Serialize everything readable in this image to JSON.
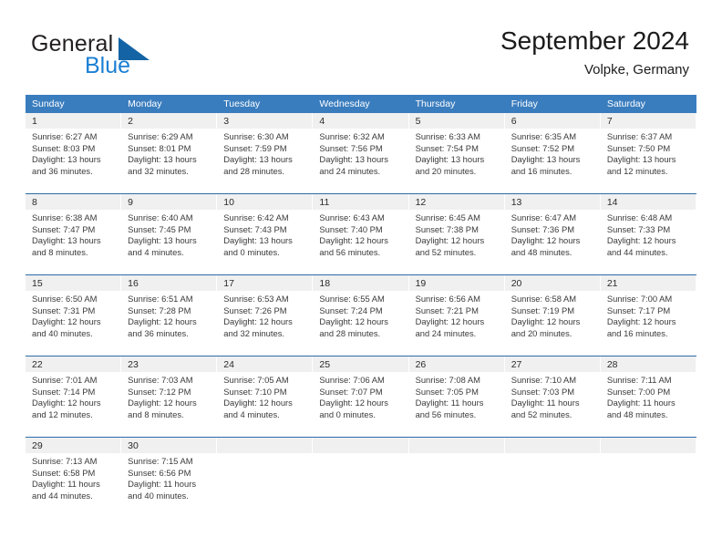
{
  "brand": {
    "name_part1": "General",
    "name_part2": "Blue",
    "mark": "triangle-logo"
  },
  "header": {
    "title": "September 2024",
    "subtitle": "Volpke, Germany"
  },
  "colors": {
    "header_blue": "#3a7dbe",
    "week_divider": "#2c6ca8",
    "daynum_band": "#f0f0f0",
    "brand_blue": "#1a7fd4"
  },
  "weekdays": [
    "Sunday",
    "Monday",
    "Tuesday",
    "Wednesday",
    "Thursday",
    "Friday",
    "Saturday"
  ],
  "weeks": [
    [
      {
        "day": "1",
        "sunrise": "Sunrise: 6:27 AM",
        "sunset": "Sunset: 8:03 PM",
        "daylight1": "Daylight: 13 hours",
        "daylight2": "and 36 minutes."
      },
      {
        "day": "2",
        "sunrise": "Sunrise: 6:29 AM",
        "sunset": "Sunset: 8:01 PM",
        "daylight1": "Daylight: 13 hours",
        "daylight2": "and 32 minutes."
      },
      {
        "day": "3",
        "sunrise": "Sunrise: 6:30 AM",
        "sunset": "Sunset: 7:59 PM",
        "daylight1": "Daylight: 13 hours",
        "daylight2": "and 28 minutes."
      },
      {
        "day": "4",
        "sunrise": "Sunrise: 6:32 AM",
        "sunset": "Sunset: 7:56 PM",
        "daylight1": "Daylight: 13 hours",
        "daylight2": "and 24 minutes."
      },
      {
        "day": "5",
        "sunrise": "Sunrise: 6:33 AM",
        "sunset": "Sunset: 7:54 PM",
        "daylight1": "Daylight: 13 hours",
        "daylight2": "and 20 minutes."
      },
      {
        "day": "6",
        "sunrise": "Sunrise: 6:35 AM",
        "sunset": "Sunset: 7:52 PM",
        "daylight1": "Daylight: 13 hours",
        "daylight2": "and 16 minutes."
      },
      {
        "day": "7",
        "sunrise": "Sunrise: 6:37 AM",
        "sunset": "Sunset: 7:50 PM",
        "daylight1": "Daylight: 13 hours",
        "daylight2": "and 12 minutes."
      }
    ],
    [
      {
        "day": "8",
        "sunrise": "Sunrise: 6:38 AM",
        "sunset": "Sunset: 7:47 PM",
        "daylight1": "Daylight: 13 hours",
        "daylight2": "and 8 minutes."
      },
      {
        "day": "9",
        "sunrise": "Sunrise: 6:40 AM",
        "sunset": "Sunset: 7:45 PM",
        "daylight1": "Daylight: 13 hours",
        "daylight2": "and 4 minutes."
      },
      {
        "day": "10",
        "sunrise": "Sunrise: 6:42 AM",
        "sunset": "Sunset: 7:43 PM",
        "daylight1": "Daylight: 13 hours",
        "daylight2": "and 0 minutes."
      },
      {
        "day": "11",
        "sunrise": "Sunrise: 6:43 AM",
        "sunset": "Sunset: 7:40 PM",
        "daylight1": "Daylight: 12 hours",
        "daylight2": "and 56 minutes."
      },
      {
        "day": "12",
        "sunrise": "Sunrise: 6:45 AM",
        "sunset": "Sunset: 7:38 PM",
        "daylight1": "Daylight: 12 hours",
        "daylight2": "and 52 minutes."
      },
      {
        "day": "13",
        "sunrise": "Sunrise: 6:47 AM",
        "sunset": "Sunset: 7:36 PM",
        "daylight1": "Daylight: 12 hours",
        "daylight2": "and 48 minutes."
      },
      {
        "day": "14",
        "sunrise": "Sunrise: 6:48 AM",
        "sunset": "Sunset: 7:33 PM",
        "daylight1": "Daylight: 12 hours",
        "daylight2": "and 44 minutes."
      }
    ],
    [
      {
        "day": "15",
        "sunrise": "Sunrise: 6:50 AM",
        "sunset": "Sunset: 7:31 PM",
        "daylight1": "Daylight: 12 hours",
        "daylight2": "and 40 minutes."
      },
      {
        "day": "16",
        "sunrise": "Sunrise: 6:51 AM",
        "sunset": "Sunset: 7:28 PM",
        "daylight1": "Daylight: 12 hours",
        "daylight2": "and 36 minutes."
      },
      {
        "day": "17",
        "sunrise": "Sunrise: 6:53 AM",
        "sunset": "Sunset: 7:26 PM",
        "daylight1": "Daylight: 12 hours",
        "daylight2": "and 32 minutes."
      },
      {
        "day": "18",
        "sunrise": "Sunrise: 6:55 AM",
        "sunset": "Sunset: 7:24 PM",
        "daylight1": "Daylight: 12 hours",
        "daylight2": "and 28 minutes."
      },
      {
        "day": "19",
        "sunrise": "Sunrise: 6:56 AM",
        "sunset": "Sunset: 7:21 PM",
        "daylight1": "Daylight: 12 hours",
        "daylight2": "and 24 minutes."
      },
      {
        "day": "20",
        "sunrise": "Sunrise: 6:58 AM",
        "sunset": "Sunset: 7:19 PM",
        "daylight1": "Daylight: 12 hours",
        "daylight2": "and 20 minutes."
      },
      {
        "day": "21",
        "sunrise": "Sunrise: 7:00 AM",
        "sunset": "Sunset: 7:17 PM",
        "daylight1": "Daylight: 12 hours",
        "daylight2": "and 16 minutes."
      }
    ],
    [
      {
        "day": "22",
        "sunrise": "Sunrise: 7:01 AM",
        "sunset": "Sunset: 7:14 PM",
        "daylight1": "Daylight: 12 hours",
        "daylight2": "and 12 minutes."
      },
      {
        "day": "23",
        "sunrise": "Sunrise: 7:03 AM",
        "sunset": "Sunset: 7:12 PM",
        "daylight1": "Daylight: 12 hours",
        "daylight2": "and 8 minutes."
      },
      {
        "day": "24",
        "sunrise": "Sunrise: 7:05 AM",
        "sunset": "Sunset: 7:10 PM",
        "daylight1": "Daylight: 12 hours",
        "daylight2": "and 4 minutes."
      },
      {
        "day": "25",
        "sunrise": "Sunrise: 7:06 AM",
        "sunset": "Sunset: 7:07 PM",
        "daylight1": "Daylight: 12 hours",
        "daylight2": "and 0 minutes."
      },
      {
        "day": "26",
        "sunrise": "Sunrise: 7:08 AM",
        "sunset": "Sunset: 7:05 PM",
        "daylight1": "Daylight: 11 hours",
        "daylight2": "and 56 minutes."
      },
      {
        "day": "27",
        "sunrise": "Sunrise: 7:10 AM",
        "sunset": "Sunset: 7:03 PM",
        "daylight1": "Daylight: 11 hours",
        "daylight2": "and 52 minutes."
      },
      {
        "day": "28",
        "sunrise": "Sunrise: 7:11 AM",
        "sunset": "Sunset: 7:00 PM",
        "daylight1": "Daylight: 11 hours",
        "daylight2": "and 48 minutes."
      }
    ],
    [
      {
        "day": "29",
        "sunrise": "Sunrise: 7:13 AM",
        "sunset": "Sunset: 6:58 PM",
        "daylight1": "Daylight: 11 hours",
        "daylight2": "and 44 minutes."
      },
      {
        "day": "30",
        "sunrise": "Sunrise: 7:15 AM",
        "sunset": "Sunset: 6:56 PM",
        "daylight1": "Daylight: 11 hours",
        "daylight2": "and 40 minutes."
      },
      {
        "day": "",
        "sunrise": "",
        "sunset": "",
        "daylight1": "",
        "daylight2": ""
      },
      {
        "day": "",
        "sunrise": "",
        "sunset": "",
        "daylight1": "",
        "daylight2": ""
      },
      {
        "day": "",
        "sunrise": "",
        "sunset": "",
        "daylight1": "",
        "daylight2": ""
      },
      {
        "day": "",
        "sunrise": "",
        "sunset": "",
        "daylight1": "",
        "daylight2": ""
      },
      {
        "day": "",
        "sunrise": "",
        "sunset": "",
        "daylight1": "",
        "daylight2": ""
      }
    ]
  ]
}
